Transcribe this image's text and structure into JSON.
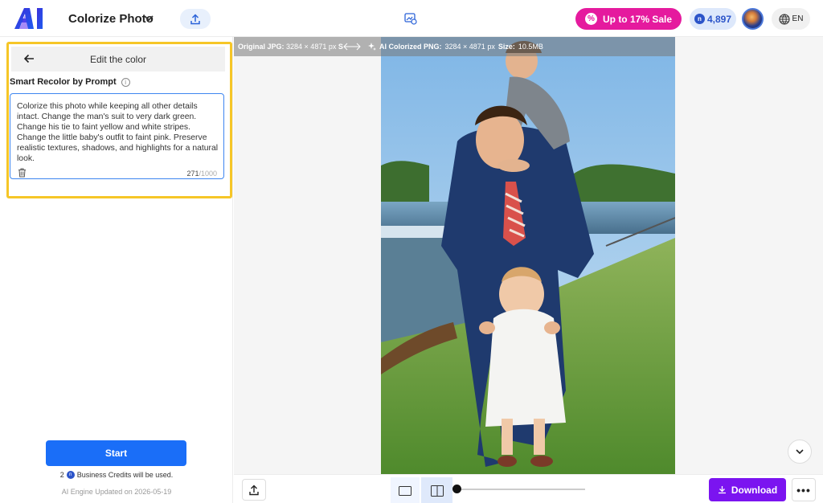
{
  "header": {
    "app_title": "Colorize Photo",
    "sale_label": "Up to 17% Sale",
    "credits": "4,897",
    "language": "EN",
    "colors": {
      "sale": "#e51a9e",
      "credits_bg": "#dde8fb",
      "accent": "#1a6ef8"
    }
  },
  "editor": {
    "title": "Edit the color",
    "section_label": "Smart Recolor by Prompt",
    "prompt_text": "Colorize this photo while keeping all other details intact. Change the man's suit to very dark green. Change his tie to faint yellow and white stripes. Change the little baby's outfit to faint pink. Preserve realistic textures, shadows, and highlights for a natural look.",
    "char_count": "271",
    "char_max": "/1000",
    "start_label": "Start",
    "credits_used_count": "2",
    "credits_used_text": "Business Credits will be used.",
    "engine_note": "AI Engine Updated on 2026-05-19"
  },
  "canvas": {
    "original_label": "Original JPG:",
    "original_dims": "3284 × 4871 px",
    "original_size_cut": "S",
    "colorized_label": "AI Colorized PNG:",
    "colorized_dims": "3284 × 4871 px",
    "size_label": "Size:",
    "size_value": "10.5MB"
  },
  "toolbar": {
    "download_label": "Download",
    "compare_level": 0
  },
  "icons": [
    "logo-icon",
    "chevron-down-icon",
    "upload-icon",
    "image-settings-icon",
    "sale-badge-icon",
    "credit-coin-icon",
    "globe-icon",
    "back-arrow-icon",
    "info-icon",
    "trash-icon",
    "swap-arrows-icon",
    "sparkle-icon",
    "single-view-icon",
    "split-view-icon",
    "download-icon",
    "more-icon"
  ]
}
